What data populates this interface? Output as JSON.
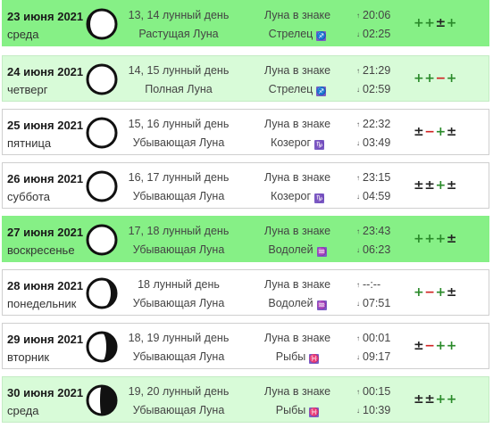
{
  "rows": [
    {
      "date": "23 июня 2021",
      "weekday": "среда",
      "lunar_day": "13, 14 лунный день",
      "phase": "Растущая Луна",
      "zodiac_label": "Луна в знаке",
      "zodiac": "Стрелец",
      "zodiac_icon": "♐",
      "rise": "20:06",
      "set": "02:25",
      "marks": [
        "+",
        "+",
        "±",
        "+"
      ],
      "highlight": "strong",
      "moon": "full-ish"
    },
    {
      "date": "24 июня 2021",
      "weekday": "четверг",
      "lunar_day": "14, 15 лунный день",
      "phase": "Полная Луна",
      "zodiac_label": "Луна в знаке",
      "zodiac": "Стрелец",
      "zodiac_icon": "♐",
      "rise": "21:29",
      "set": "02:59",
      "marks": [
        "+",
        "+",
        "−",
        "+"
      ],
      "highlight": "light",
      "moon": "full"
    },
    {
      "date": "25 июня 2021",
      "weekday": "пятница",
      "lunar_day": "15, 16 лунный день",
      "phase": "Убывающая Луна",
      "zodiac_label": "Луна в знаке",
      "zodiac": "Козерог",
      "zodiac_icon": "♑",
      "rise": "22:32",
      "set": "03:49",
      "marks": [
        "±",
        "−",
        "+",
        "±"
      ],
      "highlight": "none",
      "moon": "full"
    },
    {
      "date": "26 июня 2021",
      "weekday": "суббота",
      "lunar_day": "16, 17 лунный день",
      "phase": "Убывающая Луна",
      "zodiac_label": "Луна в знаке",
      "zodiac": "Козерог",
      "zodiac_icon": "♑",
      "rise": "23:15",
      "set": "04:59",
      "marks": [
        "±",
        "±",
        "+",
        "±"
      ],
      "highlight": "none",
      "moon": "full"
    },
    {
      "date": "27 июня 2021",
      "weekday": "воскресенье",
      "lunar_day": "17, 18 лунный день",
      "phase": "Убывающая Луна",
      "zodiac_label": "Луна в знаке",
      "zodiac": "Водолей",
      "zodiac_icon": "♒",
      "rise": "23:43",
      "set": "06:23",
      "marks": [
        "+",
        "+",
        "+",
        "±"
      ],
      "highlight": "strong",
      "moon": "full"
    },
    {
      "date": "28 июня 2021",
      "weekday": "понедельник",
      "lunar_day": "18 лунный день",
      "phase": "Убывающая Луна",
      "zodiac_label": "Луна в знаке",
      "zodiac": "Водолей",
      "zodiac_icon": "♒",
      "rise": "--:--",
      "set": "07:51",
      "marks": [
        "+",
        "−",
        "+",
        "±"
      ],
      "highlight": "none",
      "moon": "wane-slight"
    },
    {
      "date": "29 июня 2021",
      "weekday": "вторник",
      "lunar_day": "18, 19 лунный день",
      "phase": "Убывающая Луна",
      "zodiac_label": "Луна в знаке",
      "zodiac": "Рыбы",
      "zodiac_icon": "♓",
      "rise": "00:01",
      "set": "09:17",
      "marks": [
        "±",
        "−",
        "+",
        "+"
      ],
      "highlight": "none",
      "moon": "wane-more"
    },
    {
      "date": "30 июня 2021",
      "weekday": "среда",
      "lunar_day": "19, 20 лунный день",
      "phase": "Убывающая Луна",
      "zodiac_label": "Луна в знаке",
      "zodiac": "Рыбы",
      "zodiac_icon": "♓",
      "rise": "00:15",
      "set": "10:39",
      "marks": [
        "±",
        "±",
        "+",
        "+"
      ],
      "highlight": "light",
      "moon": "gibbous"
    }
  ],
  "colors": {
    "strong": "#86f086",
    "light": "#d8fbd8",
    "plus": "#2a8a2a",
    "minus": "#d02020",
    "zodiac_icon_bg": "#7b5cc4"
  },
  "icons": {
    "rise": "arrow-up-icon",
    "set": "arrow-down-icon"
  }
}
